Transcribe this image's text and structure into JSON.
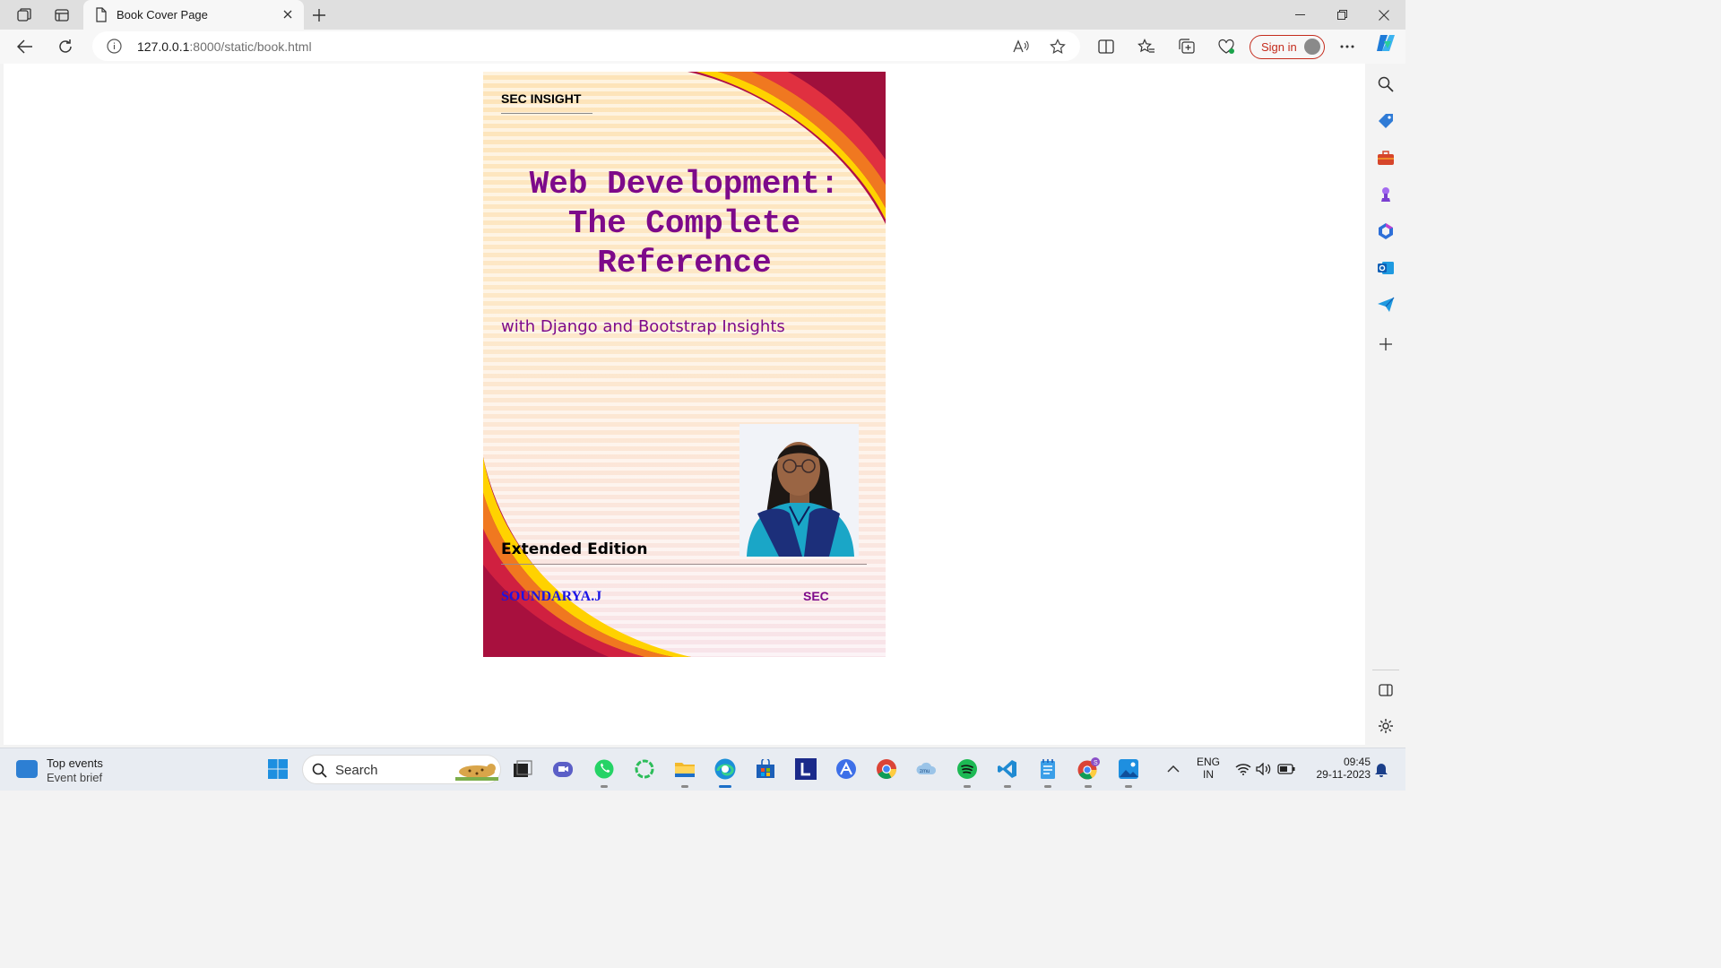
{
  "browser": {
    "tab_title": "Book Cover Page",
    "url_host": "127.0.0.1",
    "url_path": ":8000/static/book.html",
    "sign_in_label": "Sign in"
  },
  "book": {
    "publisher": "SEC INSIGHT",
    "title_line1": "Web Development:",
    "title_line2": "The Complete",
    "title_line3": "Reference",
    "subtitle": "with Django and Bootstrap Insights",
    "edition": "Extended Edition",
    "author": "SOUNDARYA.J",
    "institution": "SEC",
    "colors": {
      "title": "#7d0a8a",
      "author": "#1a14e6",
      "swoosh_dark": "#b01048",
      "swoosh_orange": "#f07820",
      "swoosh_yellow": "#ffd200"
    }
  },
  "taskbar": {
    "news_title": "Top events",
    "news_sub": "Event brief",
    "search_label": "Search",
    "lang_line1": "ENG",
    "lang_line2": "IN",
    "time": "09:45",
    "date": "29-11-2023"
  }
}
